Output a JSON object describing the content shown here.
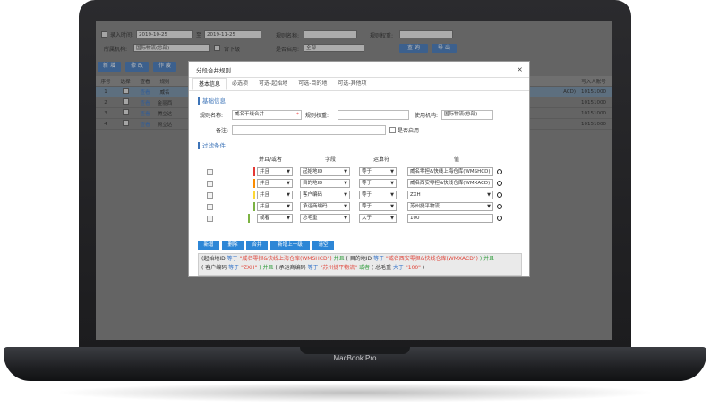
{
  "device": {
    "brand_label": "MacBook Pro"
  },
  "filters": {
    "entry_time_label": "录入时间:",
    "date_from": "2019-10-25",
    "date_sep": "至",
    "date_to": "2019-11-25",
    "rule_name_label": "规则名称:",
    "rule_weight_label": "规则权重:",
    "org_label": "所属机构:",
    "org_value": "国际物流(总部)",
    "include_sub_label": "含下级",
    "enabled_label": "是否启用:",
    "enabled_value": "全部",
    "query_button": "查 询",
    "export_button": "导 出"
  },
  "toolbar": {
    "add": "新 增",
    "edit": "修 改",
    "void": "作 废"
  },
  "grid": {
    "headers": [
      "序号",
      "选择",
      "查看",
      "规则",
      "写入人账号"
    ],
    "rows": [
      {
        "no": "1",
        "view": "查看",
        "rule": "威名",
        "note": "ACD)",
        "account": "10151000"
      },
      {
        "no": "2",
        "view": "查看",
        "rule": "金丽西",
        "note": "",
        "account": "10151000"
      },
      {
        "no": "3",
        "view": "查看",
        "rule": "腾立达",
        "note": "",
        "account": "10151000"
      },
      {
        "no": "4",
        "view": "查看",
        "rule": "腾立达",
        "note": "",
        "account": "10151000"
      }
    ]
  },
  "modal": {
    "title": "分段合并规则",
    "close_symbol": "×",
    "tabs": [
      "基本信息",
      "必选项",
      "可选-起始地",
      "可选-目的地",
      "可选-其他项"
    ],
    "basic_section": "基础信息",
    "rule_name_label": "规则名称:",
    "rule_name_value": "威名干线合并",
    "required_mark": "*",
    "rule_weight_label": "规则权重:",
    "org_label": "使用机构:",
    "org_value": "国际物流(总部)",
    "note_label": "备注:",
    "enabled_label": "是否启用",
    "condition_section": "过滤条件",
    "condition_headers": {
      "join": "并且/或者",
      "field": "字段",
      "op": "运算符",
      "value": "值"
    },
    "conditions": [
      {
        "join": "并且",
        "field": "起始地ID",
        "op": "等于",
        "value": "威名零担&快线上海仓库(WMSHCD)",
        "bar_color": "#e53935"
      },
      {
        "join": "并且",
        "field": "目的地ID",
        "op": "等于",
        "value": "威名西安零担&快线仓库(WMXACD)",
        "bar_color": "#fb8c00"
      },
      {
        "join": "并且",
        "field": "客户编码",
        "op": "等于",
        "value": "ZXH",
        "bar_color": "#fdd835"
      },
      {
        "join": "并且",
        "field": "承运商编码",
        "op": "等于",
        "value": "苏州捷平物流",
        "bar_color": "#7cb342"
      },
      {
        "join": "或者",
        "field": "总毛重",
        "op": "大于",
        "value": "100",
        "bar_color": "#7cb342"
      }
    ],
    "buttons": [
      "新增",
      "删除",
      "合并",
      "新增上一级",
      "清空"
    ],
    "expression": {
      "line1": [
        {
          "t": "(",
          "c": "n"
        },
        {
          "t": "起始地ID ",
          "c": "n"
        },
        {
          "t": "等于 ",
          "c": "k"
        },
        {
          "t": "\"威名零担&快线上海仓库(WMSHCD\")",
          "c": "v"
        },
        {
          "t": " 并且 ",
          "c": "o"
        },
        {
          "t": "( 目的地ID ",
          "c": "n"
        },
        {
          "t": "等于 ",
          "c": "k"
        },
        {
          "t": "\"威名西安零担&快线仓库(WMXACD\")",
          "c": "v"
        },
        {
          "t": " ) 并且",
          "c": "o"
        }
      ],
      "line2": [
        {
          "t": "( 客户编码 ",
          "c": "n"
        },
        {
          "t": "等于 ",
          "c": "k"
        },
        {
          "t": "\"ZXH\"",
          "c": "v"
        },
        {
          "t": " ) 并且 ",
          "c": "o"
        },
        {
          "t": "( 承运商编码 ",
          "c": "n"
        },
        {
          "t": "等于 ",
          "c": "k"
        },
        {
          "t": "\"苏州捷平物流\"",
          "c": "v"
        },
        {
          "t": " 或者 ",
          "c": "o"
        },
        {
          "t": "( 总毛重 ",
          "c": "n"
        },
        {
          "t": "大于 ",
          "c": "k"
        },
        {
          "t": "\"100\"",
          "c": "v"
        },
        {
          "t": " )",
          "c": "n"
        }
      ]
    }
  }
}
